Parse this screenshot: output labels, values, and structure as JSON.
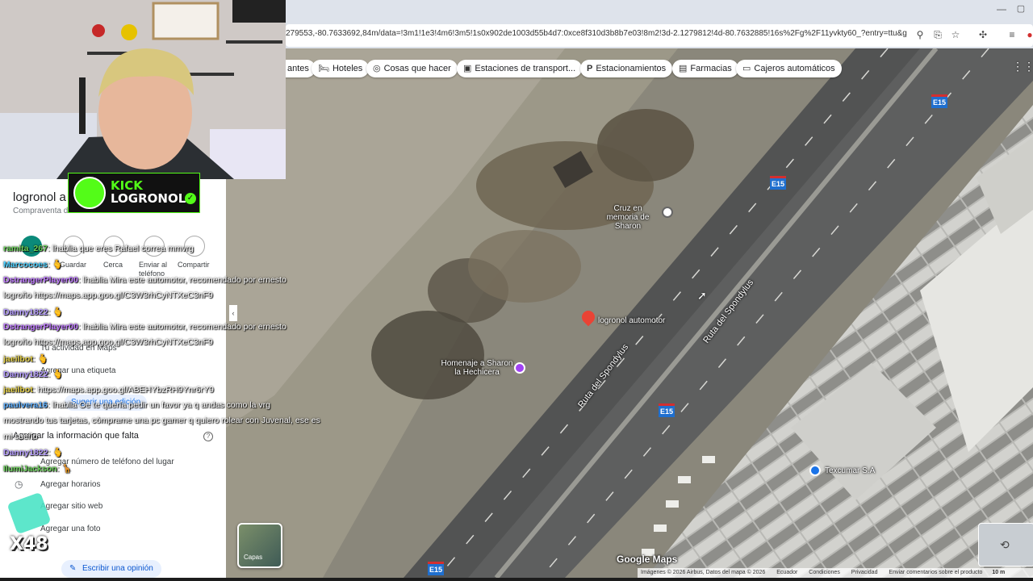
{
  "browser": {
    "url": "279553,-80.7633692,84m/data=!3m1!1e3!4m6!3m5!1s0x902de1003d55b4d7:0xce8f310d3b8b7e03!8m2!3d-2.1279812!4d-80.7632885!16s%2Fg%2F11yvkty60_?entry=ttu&g_ep=Eg..."
  },
  "map": {
    "chips": [
      {
        "label": "antes",
        "icon": ""
      },
      {
        "label": "Hoteles",
        "icon": "bed-icon"
      },
      {
        "label": "Cosas que hacer",
        "icon": "camera-icon"
      },
      {
        "label": "Estaciones de transport...",
        "icon": "bus-icon"
      },
      {
        "label": "Estacionamientos",
        "icon": "parking-icon"
      },
      {
        "label": "Farmacias",
        "icon": "pharmacy-icon"
      },
      {
        "label": "Cajeros automáticos",
        "icon": "atm-icon"
      }
    ],
    "places": {
      "cruz": "Cruz en memoria de Sharon",
      "main": "logronol automotor",
      "homenaje": "Homenaje a Sharon la Hechicera",
      "texcumar": "Texcumar S.A"
    },
    "roads": {
      "a": "Ruta del Spondylus",
      "b": "Ruta del Spondylus"
    },
    "shields": [
      "E15",
      "E15",
      "E15",
      "E15"
    ],
    "layers_label": "Capas",
    "footer": {
      "credits": "Imágenes © 2026 Airbus, Datos del mapa © 2026",
      "links": [
        "Ecuador",
        "Condiciones",
        "Privacidad",
        "Enviar comentarios sobre el producto"
      ],
      "scale": "10 m",
      "watermark": "Google Maps"
    },
    "colors": {
      "marker": "#ea4335",
      "shield": "#1f6fcf"
    }
  },
  "stream": {
    "platform": "KICK",
    "channel": "LOGRONOL",
    "multiplier": "X48"
  },
  "panel": {
    "title": "logronol a",
    "subtitle": "Compraventa de a",
    "actions": [
      "Guardar",
      "Cerca",
      "Enviar al teléfono",
      "Compartir"
    ],
    "activity": "Tu actividad en Maps",
    "label_item": "Agregar una etiqueta",
    "suggest": "Sugerir una edición",
    "missing_heading": "Agregar la información que falta",
    "missing_items": [
      "Agregar número de teléfono del lugar",
      "Agregar horarios",
      "Agregar sitio web",
      "Agregar una foto"
    ],
    "review_button": "Escribir una opinión"
  },
  "chat": [
    {
      "user": "ramita_267",
      "text": ": lhablia que eres Rafael correa mmvrg"
    },
    {
      "user": "Marcocoes",
      "text": ": 🫰"
    },
    {
      "user": "DstrangerPlayer00",
      "text": ": lhablia Mira este automotor, recomendado por ernesto"
    },
    {
      "user": "",
      "text": "logroño https://maps.app.goo.gl/C3W3rhCyNTXeC3nF9"
    },
    {
      "user": "Danny1822",
      "text": ": 🫰"
    },
    {
      "user": "DstrangerPlayer00",
      "text": ": lhablia Mira este automotor, recomendado por ernesto"
    },
    {
      "user": "",
      "text": "logroño https://maps.app.goo.gl/C3W3rhCyNTXeC3nF9"
    },
    {
      "user": "jaeilbot",
      "text": ": 🫰"
    },
    {
      "user": "Danny1822",
      "text": ": 🫰"
    },
    {
      "user": "jaeilbot",
      "text": ": https://maps.app.goo.gl/ABEHYbzRH9Ynr6rY9"
    },
    {
      "user": "paulvera16",
      "text": ": lhablia Oe te quería pedir un favor ya q andas como la vrg"
    },
    {
      "user": "",
      "text": "mostrando tus tarjetas, cómprame una pc gamer q quiero rolear con Juvenal, ese es"
    },
    {
      "user": "",
      "text": "mi sueño"
    },
    {
      "user": "Danny1822",
      "text": ": 🫰"
    },
    {
      "user": "IlumiJackson",
      "text": ": 🦒"
    }
  ]
}
